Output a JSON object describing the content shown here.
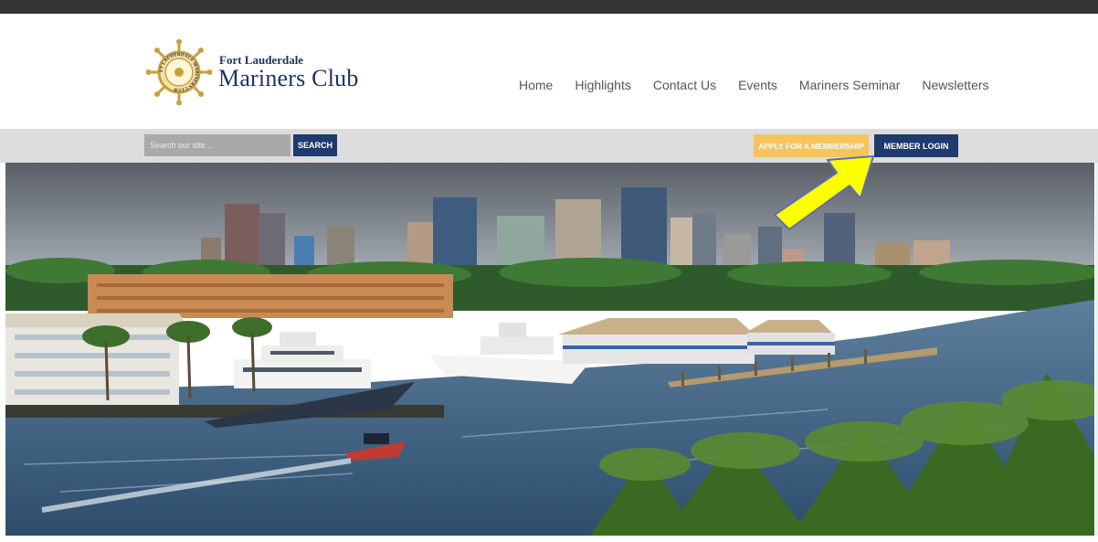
{
  "logo": {
    "line1": "Fort Lauderdale",
    "line2": "Mariners Club",
    "ring_text": "FT LAUDERDALE MARINERS CLUB",
    "gold_color": "#c9a03a",
    "navy_color": "#1f3260"
  },
  "nav": {
    "items": [
      "Home",
      "Highlights",
      "Contact Us",
      "Events",
      "Mariners Seminar",
      "Newsletters"
    ]
  },
  "search": {
    "placeholder": "Search our site...",
    "value": "",
    "button_label": "SEARCH"
  },
  "actions": {
    "apply_label": "APPLY FOR A MEMBERSHIP",
    "login_label": "MEMBER LOGIN"
  },
  "colors": {
    "top_bar": "#333333",
    "sub_bar": "#dcdcdc",
    "navy": "#1f3a6d",
    "gold_button": "#f6c45c",
    "annotation_arrow": "#ffff00"
  },
  "hero": {
    "subject": "Fort Lauderdale skyline and marina with yachts, waterway and palm trees"
  }
}
